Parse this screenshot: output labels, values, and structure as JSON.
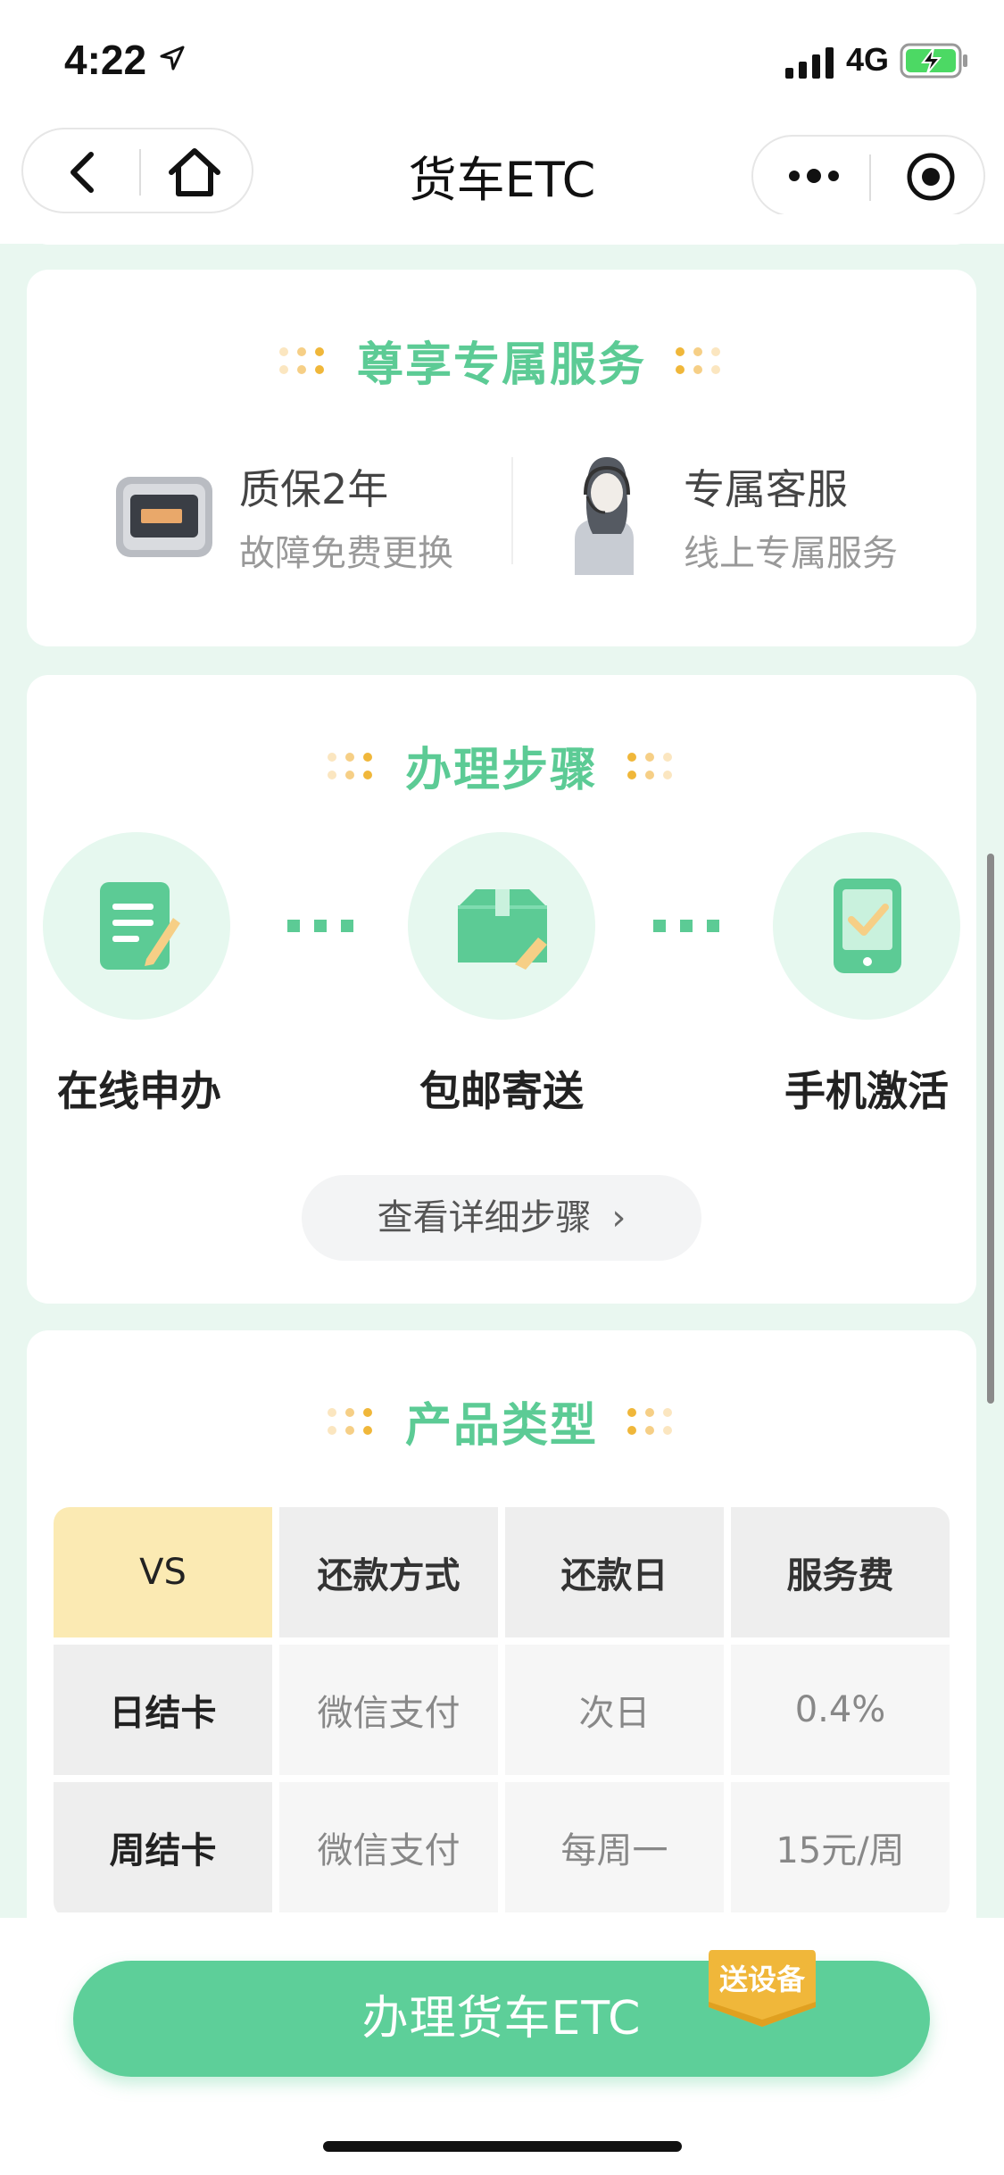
{
  "status_bar": {
    "time": "4:22",
    "network": "4G"
  },
  "nav": {
    "title": "货车ETC"
  },
  "colors": {
    "accent": "#5ccb95",
    "vs_header": "#fbeab3",
    "gold": "#f0b73a"
  },
  "services": {
    "title": "尊享专属服务",
    "items": [
      {
        "title": "质保2年",
        "subtitle": "故障免费更换",
        "icon": "etc-device-icon"
      },
      {
        "title": "专属客服",
        "subtitle": "线上专属服务",
        "icon": "customer-service-icon"
      }
    ]
  },
  "steps": {
    "title": "办理步骤",
    "items": [
      {
        "label": "在线申办",
        "icon": "document-edit-icon"
      },
      {
        "label": "包邮寄送",
        "icon": "package-icon"
      },
      {
        "label": "手机激活",
        "icon": "phone-check-icon"
      }
    ],
    "detail_button": "查看详细步骤"
  },
  "products": {
    "title": "产品类型",
    "headers": [
      "VS",
      "还款方式",
      "还款日",
      "服务费"
    ],
    "rows": [
      [
        "日结卡",
        "微信支付",
        "次日",
        "0.4%"
      ],
      [
        "周结卡",
        "微信支付",
        "每周一",
        "15元/周"
      ]
    ]
  },
  "cta": {
    "label": "办理货车ETC",
    "badge": "送设备"
  }
}
